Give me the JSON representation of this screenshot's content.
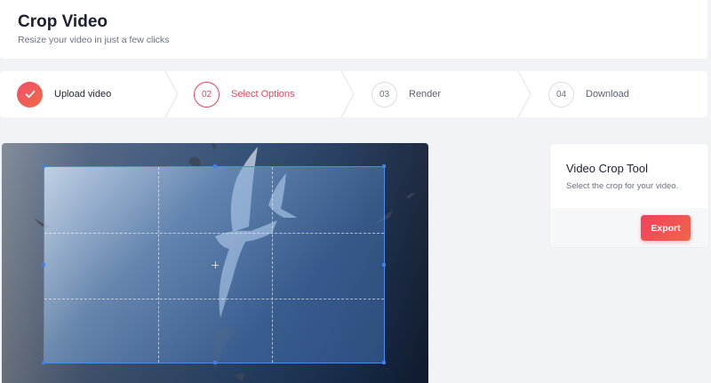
{
  "header": {
    "title": "Crop Video",
    "subtitle": "Resize your video in just a few clicks"
  },
  "steps": [
    {
      "number": "",
      "label": "Upload video",
      "state": "done",
      "icon": "check-icon"
    },
    {
      "number": "02",
      "label": "Select Options",
      "state": "active"
    },
    {
      "number": "03",
      "label": "Render",
      "state": "pending"
    },
    {
      "number": "04",
      "label": "Download",
      "state": "pending"
    }
  ],
  "panel": {
    "title": "Video Crop Tool",
    "description": "Select the crop for your video.",
    "export_label": "Export"
  },
  "colors": {
    "accent": "#e6445e",
    "crop_border": "#4b8cf0",
    "background": "#f2f3f6"
  }
}
